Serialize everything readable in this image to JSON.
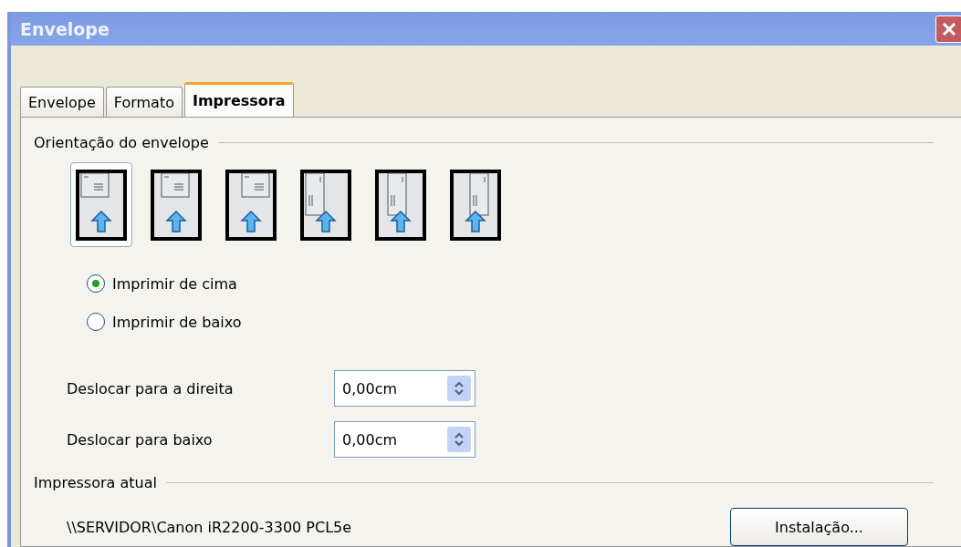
{
  "window": {
    "title": "Envelope"
  },
  "tabs": [
    {
      "label": "Envelope",
      "selected": false
    },
    {
      "label": "Formato",
      "selected": false
    },
    {
      "label": "Impressora",
      "selected": true
    }
  ],
  "orientation": {
    "title": "Orientação do envelope",
    "options": [
      {
        "selected": true,
        "kind": "hleft"
      },
      {
        "selected": false,
        "kind": "hcenter"
      },
      {
        "selected": false,
        "kind": "hright"
      },
      {
        "selected": false,
        "kind": "vleft"
      },
      {
        "selected": false,
        "kind": "vcenter"
      },
      {
        "selected": false,
        "kind": "vright"
      }
    ],
    "radios": [
      {
        "label": "Imprimir de cima",
        "selected": true
      },
      {
        "label": "Imprimir de baixo",
        "selected": false
      }
    ],
    "shifts": [
      {
        "label": "Deslocar para a direita",
        "value": "0,00cm"
      },
      {
        "label": "Deslocar para baixo",
        "value": "0,00cm"
      }
    ]
  },
  "printer": {
    "title": "Impressora atual",
    "name": "\\\\SERVIDOR\\Canon iR2200-3300 PCL5e",
    "button": "Instalação..."
  }
}
